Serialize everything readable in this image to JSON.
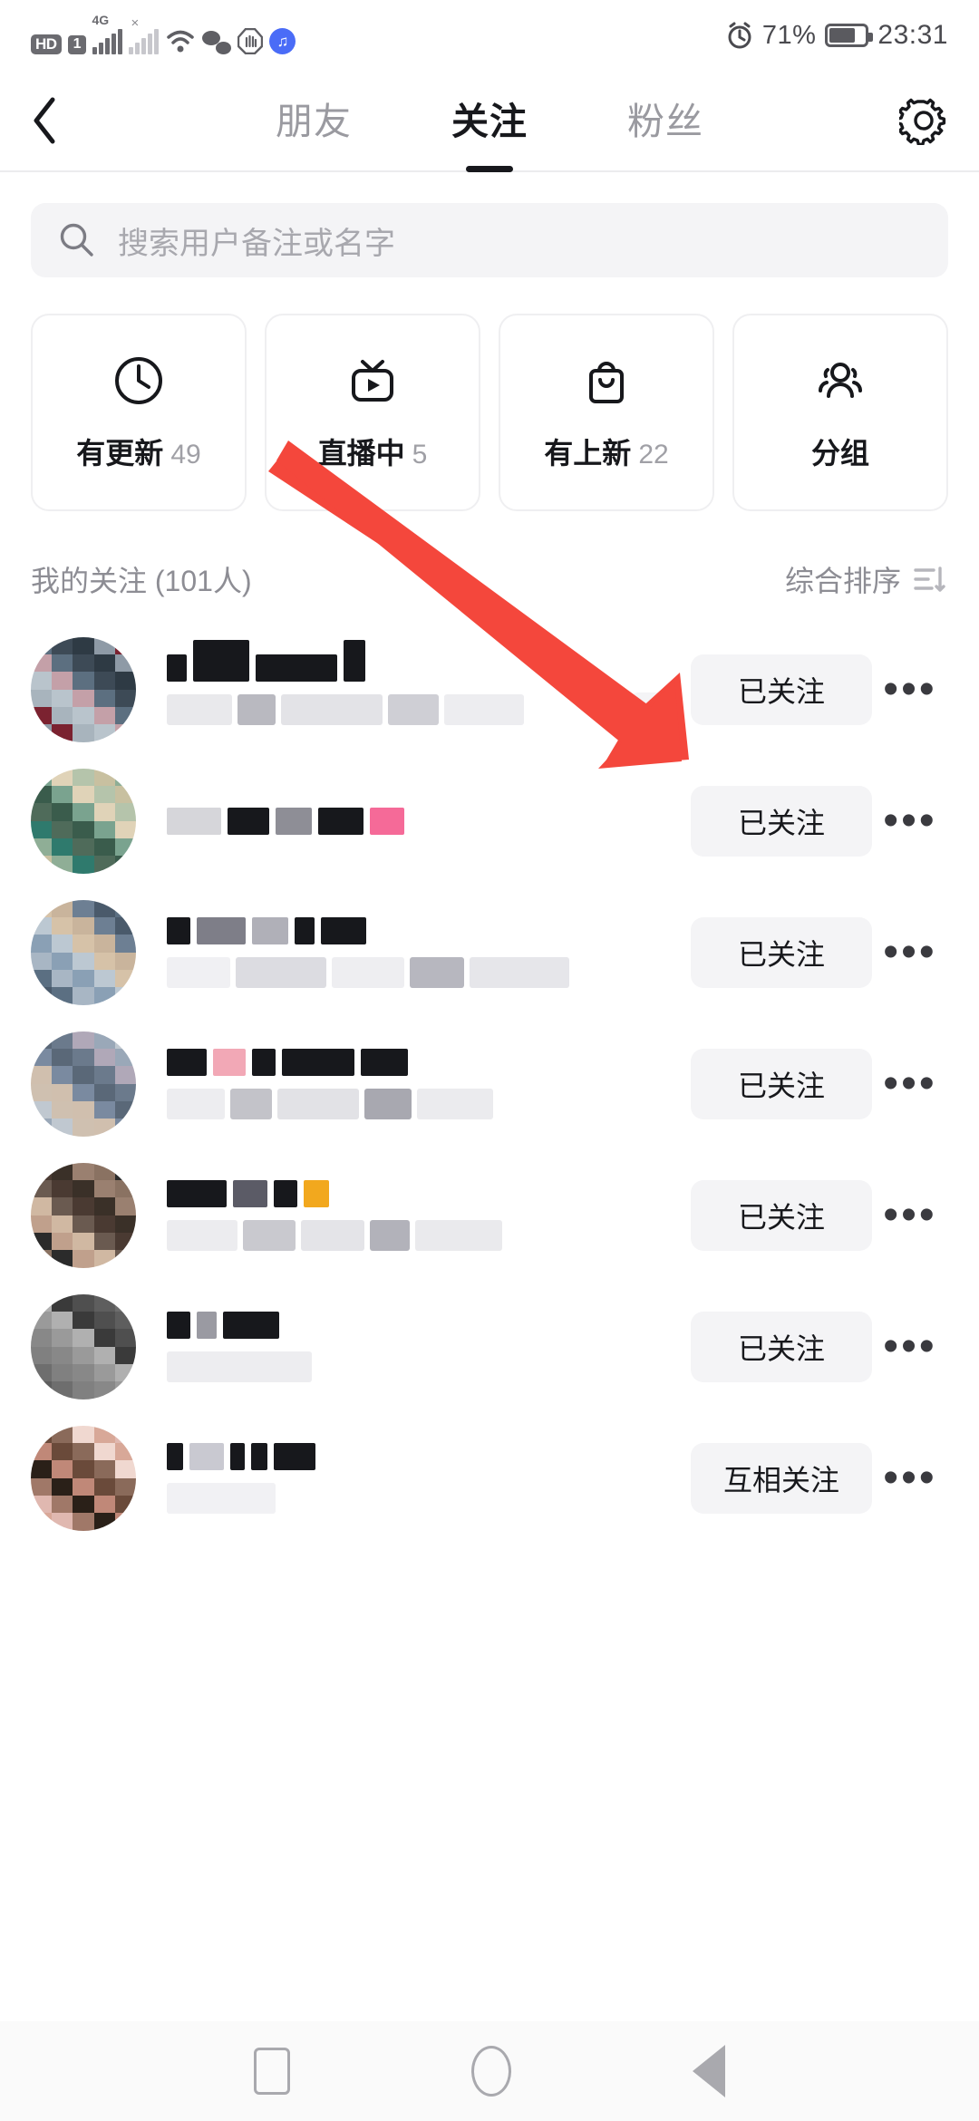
{
  "status_bar": {
    "hd_label": "HD",
    "sim_label": "1",
    "network_label": "4G",
    "signal_x": "×",
    "alarm_icon": "alarm-clock-icon",
    "battery_percent": "71%",
    "time": "23:31"
  },
  "top_bar": {
    "back_icon": "chevron-left-icon",
    "settings_icon": "gear-icon",
    "tabs": [
      {
        "label": "朋友",
        "active": false
      },
      {
        "label": "关注",
        "active": true
      },
      {
        "label": "粉丝",
        "active": false
      }
    ]
  },
  "search": {
    "icon": "search-icon",
    "placeholder": "搜索用户备注或名字",
    "value": ""
  },
  "filter_cards": [
    {
      "icon": "clock-icon",
      "label": "有更新",
      "count": "49"
    },
    {
      "icon": "live-tv-icon",
      "label": "直播中",
      "count": "5"
    },
    {
      "icon": "shopping-bag-icon",
      "label": "有上新",
      "count": "22"
    },
    {
      "icon": "group-people-icon",
      "label": "分组",
      "count": ""
    }
  ],
  "list_header": {
    "title": "我的关注 (101人)",
    "sort_label": "综合排序",
    "sort_icon": "sort-icon"
  },
  "list_rows": [
    {
      "follow_label": "已关注",
      "more_label": "•••",
      "has_chevron_badge": true
    },
    {
      "follow_label": "已关注",
      "more_label": "•••",
      "has_chevron_badge": false
    },
    {
      "follow_label": "已关注",
      "more_label": "•••",
      "has_chevron_badge": false
    },
    {
      "follow_label": "已关注",
      "more_label": "•••",
      "has_chevron_badge": false
    },
    {
      "follow_label": "已关注",
      "more_label": "•••",
      "has_chevron_badge": false
    },
    {
      "follow_label": "已关注",
      "more_label": "•••",
      "has_chevron_badge": false
    },
    {
      "follow_label": "互相关注",
      "more_label": "•••",
      "has_chevron_badge": false
    }
  ],
  "annotation": {
    "type": "red-arrow",
    "color": "#f4473c"
  },
  "bottom_nav": [
    {
      "icon": "recents-square-icon"
    },
    {
      "icon": "home-circle-icon"
    },
    {
      "icon": "back-triangle-icon"
    }
  ]
}
